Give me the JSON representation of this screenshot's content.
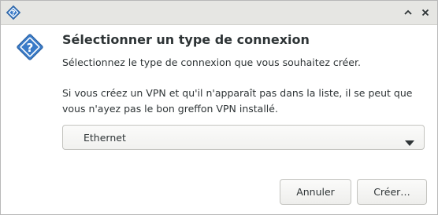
{
  "window": {
    "minimize_icon": "chevron-up",
    "close_icon": "close-x"
  },
  "dialog": {
    "icon": "question-diamond",
    "title": "Sélectionner un type de connexion",
    "subtitle": "Sélectionnez le type de connexion que vous souhaitez créer.",
    "note": "Si vous créez un VPN et qu'il n'apparaît pas dans la liste, il se peut que vous n'ayez pas le bon greffon VPN installé.",
    "connection_type": {
      "selected": "Ethernet"
    }
  },
  "buttons": {
    "cancel_label": "Annuler",
    "create_label": "Créer…"
  },
  "colors": {
    "icon_blue": "#3a7bc8",
    "titlebar_bg": "#e6e6e3",
    "text": "#2e3436"
  }
}
